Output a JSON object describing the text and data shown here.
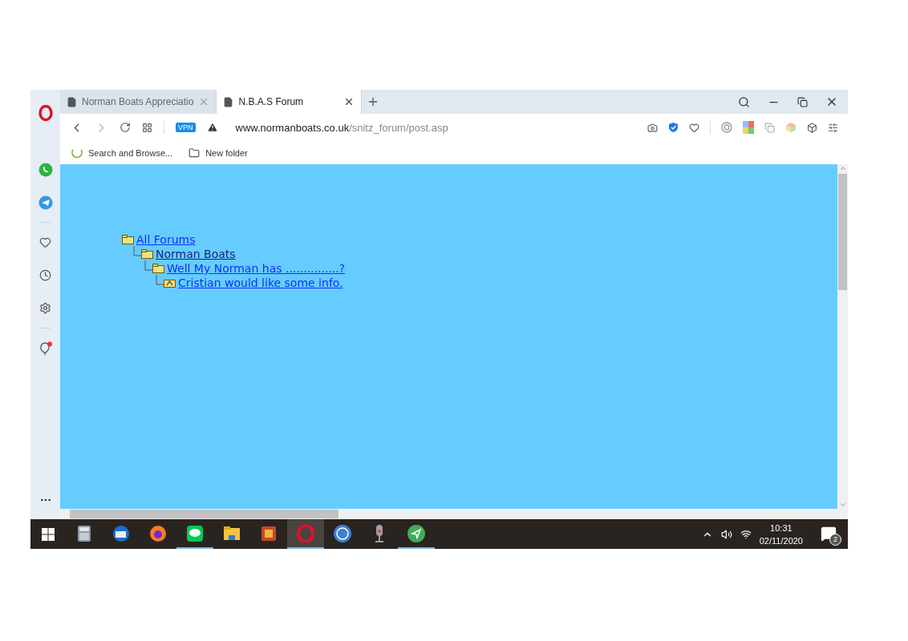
{
  "tabs": [
    {
      "title": "Norman Boats Appreciatio",
      "selected": false
    },
    {
      "title": "N.B.A.S Forum",
      "selected": true
    }
  ],
  "address": {
    "badge": "VPN",
    "host": "www.normanboats.co.uk",
    "path": "/snitz_forum/post.asp"
  },
  "bookmarks": [
    {
      "kind": "site",
      "label": "Search and Browse..."
    },
    {
      "kind": "folder",
      "label": "New folder"
    }
  ],
  "tree": [
    {
      "kind": "folder",
      "label": "All Forums",
      "visited": false,
      "children": [
        {
          "kind": "folder",
          "label": "Norman Boats",
          "visited": true,
          "children": [
            {
              "kind": "folder",
              "label": "Well My Norman has ...............?",
              "visited": false,
              "children": [
                {
                  "kind": "topic",
                  "label": "Cristian would like some info.",
                  "visited": false
                }
              ]
            }
          ]
        }
      ]
    }
  ],
  "taskbar": {
    "apps": [
      {
        "running": false,
        "selected": false
      },
      {
        "running": false,
        "selected": false
      },
      {
        "running": false,
        "selected": false
      },
      {
        "running": true,
        "selected": false
      },
      {
        "running": false,
        "selected": false
      },
      {
        "running": false,
        "selected": false
      },
      {
        "running": true,
        "selected": true
      },
      {
        "running": false,
        "selected": false
      },
      {
        "running": false,
        "selected": false
      },
      {
        "running": true,
        "selected": false
      }
    ],
    "time": "10:31",
    "date": "02/11/2020",
    "notifications": "2"
  }
}
